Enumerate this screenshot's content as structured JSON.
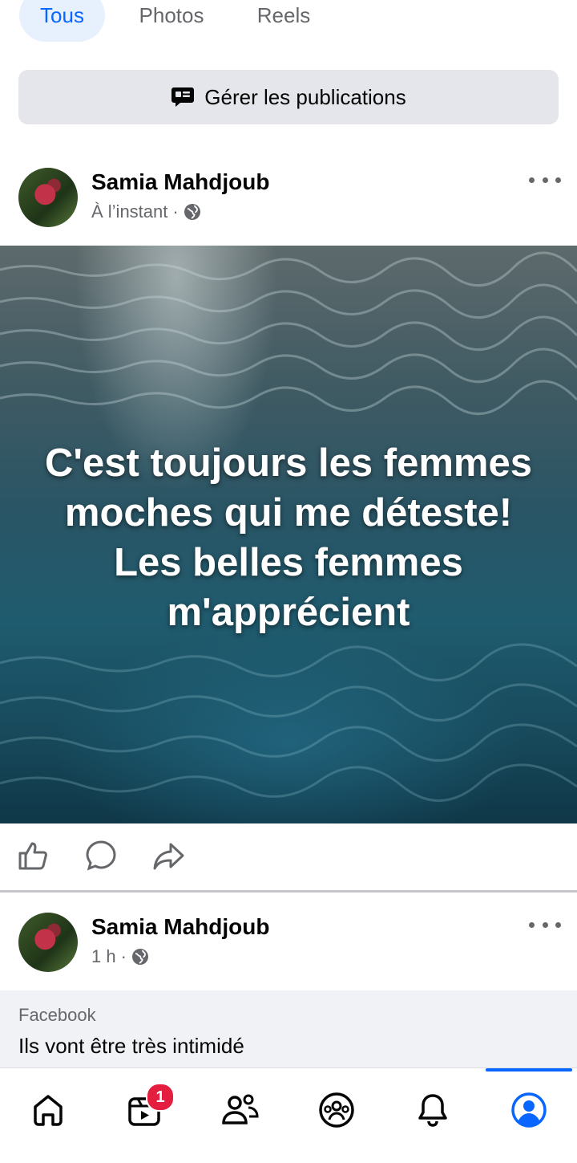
{
  "tabs": [
    {
      "label": "Tous"
    },
    {
      "label": "Photos"
    },
    {
      "label": "Reels"
    }
  ],
  "manage_posts": {
    "label": "Gérer les publications",
    "icon": "manage-posts-icon"
  },
  "posts": [
    {
      "author": "Samia Mahdjoub",
      "time": "À l’instant",
      "separator": "·",
      "privacy_icon": "globe-icon",
      "image_text": "C'est toujours les femmes moches qui me déteste! Les belles femmes m'apprécient"
    },
    {
      "author": "Samia Mahdjoub",
      "time": "1 h",
      "separator": "·",
      "privacy_icon": "globe-icon",
      "shared_source": "Facebook",
      "shared_title": "Ils vont être très intimidé"
    }
  ],
  "actions": [
    "like-icon",
    "comment-icon",
    "share-icon"
  ],
  "bottom_nav": {
    "items": [
      "home-icon",
      "video-icon",
      "friends-icon",
      "groups-icon",
      "notifications-icon",
      "profile-icon"
    ],
    "video_badge": "1",
    "active": "profile-icon",
    "accent": "#0866ff"
  },
  "colors": {
    "accent": "#0866ff",
    "badge": "#e41e3f"
  }
}
